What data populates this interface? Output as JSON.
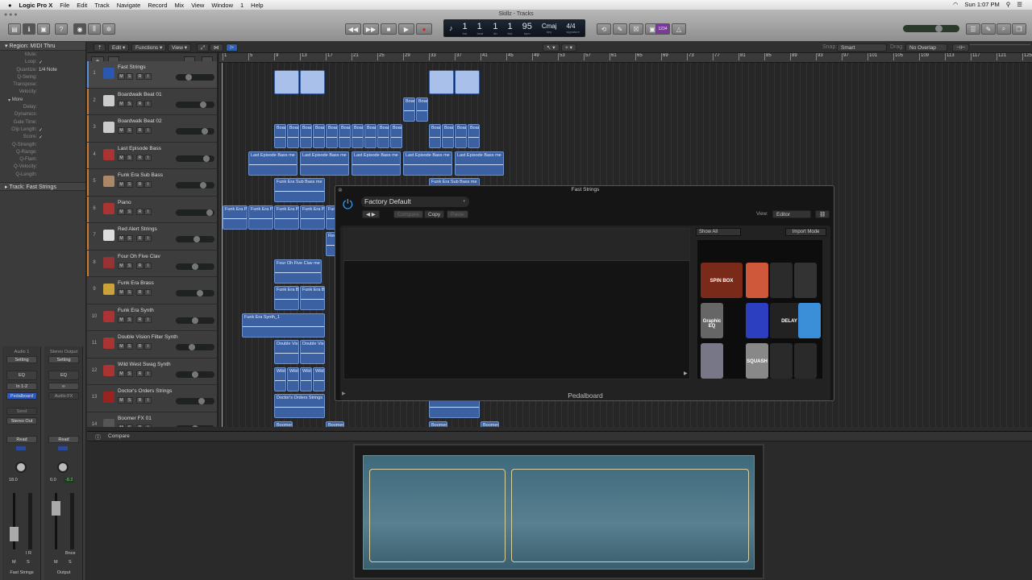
{
  "menubar": {
    "app": "Logic Pro X",
    "items": [
      "File",
      "Edit",
      "Track",
      "Navigate",
      "Record",
      "Mix",
      "View",
      "Window",
      "1",
      "Help"
    ],
    "clock": "Sun 1:07 PM"
  },
  "window": {
    "title": "Skillz - Tracks"
  },
  "lcd": {
    "bar": "1",
    "beat": "1",
    "div": "1",
    "tick": "1",
    "bar_label": "bar",
    "beat_label": "beat",
    "div_label": "div",
    "tick_label": "tick",
    "tempo": "95",
    "tempo_label": "bpm",
    "key": "Cmaj",
    "key_label": "key",
    "signature": "4/4",
    "signature_label": "signature"
  },
  "toolbar": {
    "count_in": "1234"
  },
  "localbar": {
    "edit": "Edit",
    "functions": "Functions",
    "view": "View",
    "snap_label": "Snap:",
    "snap": "Smart",
    "drag_label": "Drag:",
    "drag": "No Overlap"
  },
  "inspector": {
    "region_header": "Region: MIDI Thru",
    "params": [
      {
        "k": "Mute:",
        "v": ""
      },
      {
        "k": "Loop:",
        "v": "✓"
      },
      {
        "k": "Quantize:",
        "v": "1/4 Note"
      },
      {
        "k": "Q-Swing:",
        "v": ""
      },
      {
        "k": "Transpose:",
        "v": ""
      },
      {
        "k": "Velocity:",
        "v": ""
      }
    ],
    "more": "More",
    "more_params": [
      {
        "k": "Delay:",
        "v": ""
      },
      {
        "k": "Dynamics:",
        "v": ""
      },
      {
        "k": "Gate Time:",
        "v": ""
      },
      {
        "k": "Clip Length:",
        "v": "✓"
      },
      {
        "k": "Score:",
        "v": "✓"
      },
      {
        "k": "Q-Strength:",
        "v": ""
      },
      {
        "k": "Q-Range:",
        "v": ""
      },
      {
        "k": "Q-Flam:",
        "v": ""
      },
      {
        "k": "Q-Velocity:",
        "v": ""
      },
      {
        "k": "Q-Length:",
        "v": ""
      }
    ],
    "track_header": "Track:  Fast Strings",
    "strip1": {
      "top": "Audio 1",
      "setting": "Setting",
      "eq": "EQ",
      "input": "In 1-2",
      "plugin": "Pedalboard",
      "send": "Send",
      "output": "Stereo Out",
      "read": "Read",
      "vol": "18.0",
      "ir": "I  R",
      "m": "M",
      "s": "S",
      "name": "Fast Strings"
    },
    "strip2": {
      "top": "Stereo Output",
      "setting": "Setting",
      "eq": "EQ",
      "fx": "Audio FX",
      "read": "Read",
      "vol": "0.0",
      "peak": "-8.2",
      "bnce": "Bnce",
      "m": "M",
      "s": "S",
      "name": "Output"
    }
  },
  "tracks": [
    {
      "n": "1",
      "name": "Fast Strings",
      "color": "#5a8fe0",
      "icon": "#2a57b0"
    },
    {
      "n": "2",
      "name": "Boardwalk Beat 01",
      "color": "#d07a30",
      "icon": "#ccc"
    },
    {
      "n": "3",
      "name": "Boardwalk Beat 02",
      "color": "#d07a30",
      "icon": "#ccc"
    },
    {
      "n": "4",
      "name": "Last Episode Bass",
      "color": "#d07a30",
      "icon": "#a33"
    },
    {
      "n": "5",
      "name": "Funk Era Sub Bass",
      "color": "#d07a30",
      "icon": "#a86"
    },
    {
      "n": "6",
      "name": "Piano",
      "color": "#d07a30",
      "icon": "#a33"
    },
    {
      "n": "7",
      "name": "Red Alert Strings",
      "color": "#d07a30",
      "icon": "#ddd"
    },
    {
      "n": "8",
      "name": "Four Oh Five Clav",
      "color": "#d07a30",
      "icon": "#933"
    },
    {
      "n": "9",
      "name": "Funk Era Brass",
      "color": "#3d3d3d",
      "icon": "#c9a23a"
    },
    {
      "n": "10",
      "name": "Funk Era Synth",
      "color": "#3d3d3d",
      "icon": "#a33"
    },
    {
      "n": "11",
      "name": "Double Vision Filter Synth",
      "color": "#3d3d3d",
      "icon": "#a33"
    },
    {
      "n": "12",
      "name": "Wild West Swag Synth",
      "color": "#3d3d3d",
      "icon": "#a33"
    },
    {
      "n": "13",
      "name": "Doctor's Orders Strings",
      "color": "#3d3d3d",
      "icon": "#922"
    },
    {
      "n": "14",
      "name": "Boomer FX 01",
      "color": "#3d3d3d",
      "icon": "#555"
    }
  ],
  "track_buttons": [
    "M",
    "S",
    "R",
    "I"
  ],
  "track_volumes": [
    0.3,
    0.75,
    0.8,
    0.85,
    0.75,
    0.95,
    0.55,
    0.5,
    0.65,
    0.5,
    0.4,
    0.5,
    0.7,
    0.5
  ],
  "ruler": [
    1,
    5,
    9,
    13,
    17,
    21,
    25,
    29,
    33,
    37,
    41,
    45,
    49,
    53,
    57,
    61,
    65,
    69,
    73,
    77,
    81,
    85,
    89,
    93,
    97,
    101,
    105,
    109,
    113,
    117,
    121,
    125
  ],
  "regions": [
    {
      "t": 0,
      "s": 9,
      "l": 4,
      "label": "",
      "midi": true
    },
    {
      "t": 0,
      "s": 13,
      "l": 4,
      "label": "",
      "midi": true
    },
    {
      "t": 0,
      "s": 33,
      "l": 4,
      "label": "",
      "midi": true
    },
    {
      "t": 0,
      "s": 37,
      "l": 4,
      "label": "",
      "midi": true
    },
    {
      "t": 1,
      "s": 29,
      "l": 2,
      "label": "Boar"
    },
    {
      "t": 1,
      "s": 31,
      "l": 2,
      "label": "Boar"
    },
    {
      "t": 2,
      "s": 9,
      "l": 2,
      "label": "Boar"
    },
    {
      "t": 2,
      "s": 11,
      "l": 2,
      "label": "Boar"
    },
    {
      "t": 2,
      "s": 13,
      "l": 2,
      "label": "Boar"
    },
    {
      "t": 2,
      "s": 15,
      "l": 2,
      "label": "Boar"
    },
    {
      "t": 2,
      "s": 17,
      "l": 2,
      "label": "Boar"
    },
    {
      "t": 2,
      "s": 19,
      "l": 2,
      "label": "Boar"
    },
    {
      "t": 2,
      "s": 21,
      "l": 2,
      "label": "Boar"
    },
    {
      "t": 2,
      "s": 23,
      "l": 2,
      "label": "Boar"
    },
    {
      "t": 2,
      "s": 25,
      "l": 2,
      "label": "Boar"
    },
    {
      "t": 2,
      "s": 27,
      "l": 2,
      "label": "Boar"
    },
    {
      "t": 2,
      "s": 33,
      "l": 2,
      "label": "Boar"
    },
    {
      "t": 2,
      "s": 35,
      "l": 2,
      "label": "Boar"
    },
    {
      "t": 2,
      "s": 37,
      "l": 2,
      "label": "Boar"
    },
    {
      "t": 2,
      "s": 39,
      "l": 2,
      "label": "Boar"
    },
    {
      "t": 3,
      "s": 5,
      "l": 7.7,
      "label": "Last Episode Bass me"
    },
    {
      "t": 3,
      "s": 13,
      "l": 7.7,
      "label": "Last Episode Bass me"
    },
    {
      "t": 3,
      "s": 21,
      "l": 7.7,
      "label": "Last Episode Bass me"
    },
    {
      "t": 3,
      "s": 29,
      "l": 7.7,
      "label": "Last Episode Bass me"
    },
    {
      "t": 3,
      "s": 37,
      "l": 7.7,
      "label": "Last Episode Bass me"
    },
    {
      "t": 4,
      "s": 9,
      "l": 8,
      "label": "Funk Era Sub Bass me"
    },
    {
      "t": 4,
      "s": 33,
      "l": 8,
      "label": "Funk Era Sub Bass me"
    },
    {
      "t": 5,
      "s": 1,
      "l": 4,
      "label": "Funk Era P"
    },
    {
      "t": 5,
      "s": 5,
      "l": 4,
      "label": "Funk Era P"
    },
    {
      "t": 5,
      "s": 9,
      "l": 4,
      "label": "Funk Era P"
    },
    {
      "t": 5,
      "s": 13,
      "l": 4,
      "label": "Funk Era P"
    },
    {
      "t": 5,
      "s": 17,
      "l": 4,
      "label": "Funk Era P"
    },
    {
      "t": 6,
      "s": 17,
      "l": 4,
      "label": "Red Alert"
    },
    {
      "t": 7,
      "s": 9,
      "l": 7.5,
      "label": "Four Oh Five Clav me"
    },
    {
      "t": 8,
      "s": 9,
      "l": 4,
      "label": "Funk Era B"
    },
    {
      "t": 8,
      "s": 13,
      "l": 4,
      "label": "Funk Era B"
    },
    {
      "t": 9,
      "s": 4,
      "l": 13,
      "label": "Funk Era Synth_1"
    },
    {
      "t": 10,
      "s": 9,
      "l": 4,
      "label": "Double Vis"
    },
    {
      "t": 10,
      "s": 13,
      "l": 4,
      "label": "Double Vis"
    },
    {
      "t": 11,
      "s": 9,
      "l": 2,
      "label": "Wild"
    },
    {
      "t": 11,
      "s": 11,
      "l": 2,
      "label": "Wild"
    },
    {
      "t": 11,
      "s": 13,
      "l": 2,
      "label": "Wild"
    },
    {
      "t": 11,
      "s": 15,
      "l": 2,
      "label": "Wild"
    },
    {
      "t": 12,
      "s": 9,
      "l": 8,
      "label": "Doctor's Orders Strings"
    },
    {
      "t": 12,
      "s": 33,
      "l": 8,
      "label": "Doctor's Orders Strings"
    },
    {
      "t": 13,
      "s": 9,
      "l": 3,
      "label": "Boomer"
    },
    {
      "t": 13,
      "s": 17,
      "l": 3,
      "label": "Boomer"
    },
    {
      "t": 13,
      "s": 33,
      "l": 3,
      "label": "Boomer"
    },
    {
      "t": 13,
      "s": 41,
      "l": 3,
      "label": "Boomer"
    }
  ],
  "plugin": {
    "title": "Fast Strings",
    "preset": "Factory Default",
    "compare": "Compare",
    "copy": "Copy",
    "paste": "Paste",
    "view_label": "View:",
    "view": "Editor",
    "filter": "Show All",
    "import": "Import Mode",
    "name": "Pedalboard",
    "pedals": [
      {
        "name": "SPIN BOX",
        "color": "#7a2a18"
      },
      {
        "name": "",
        "color": "#d0583a"
      },
      {
        "name": "",
        "color": "#2b2b2b"
      },
      {
        "name": "",
        "color": "#333"
      },
      {
        "name": "Graphic EQ",
        "color": "#666"
      },
      {
        "name": "",
        "color": "#2b3fc0"
      },
      {
        "name": "DELAY",
        "color": "#222"
      },
      {
        "name": "",
        "color": "#3a8fd8"
      },
      {
        "name": "",
        "color": "#778"
      },
      {
        "name": "SQUASH",
        "color": "#888"
      },
      {
        "name": "",
        "color": "#2a2a2a"
      },
      {
        "name": "",
        "color": "#2a2a2a"
      }
    ]
  },
  "editor": {
    "compare": "Compare"
  }
}
